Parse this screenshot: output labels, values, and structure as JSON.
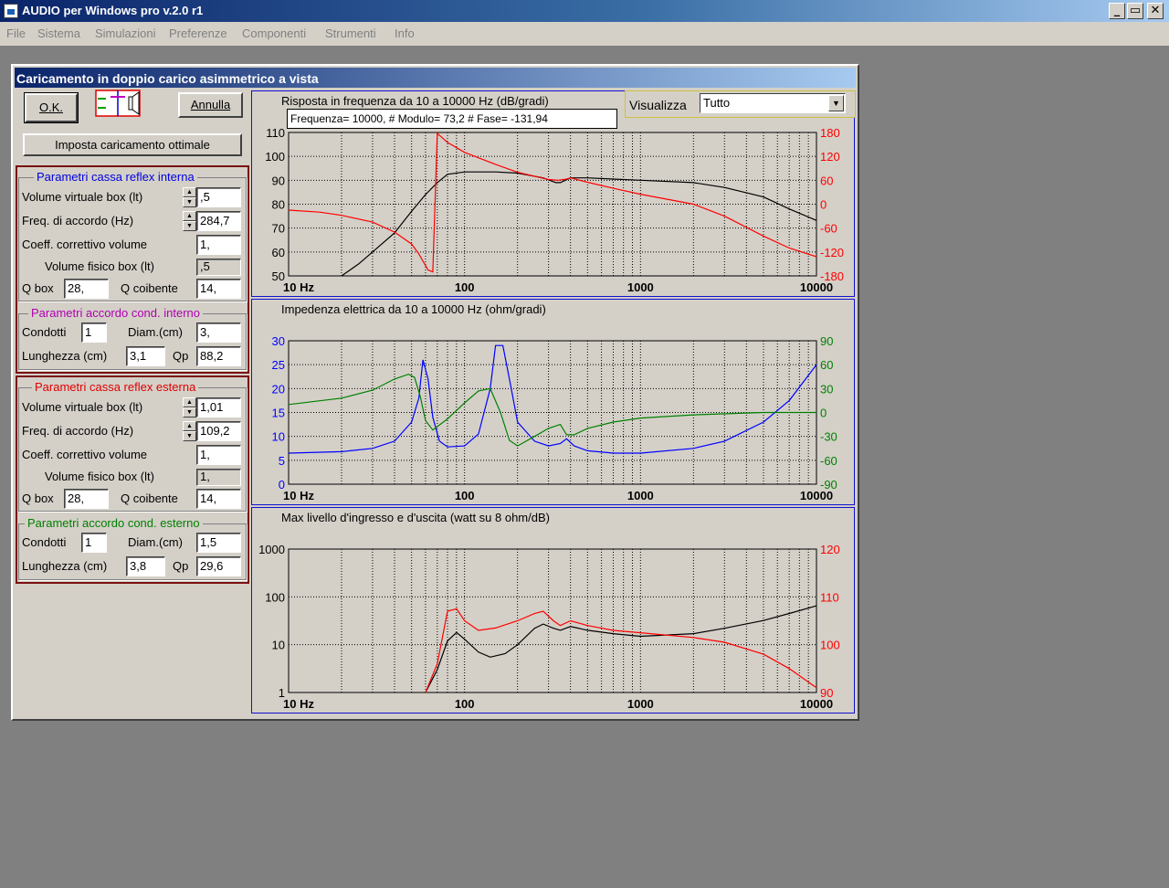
{
  "window": {
    "title": "AUDIO per Windows pro v.2.0 r1",
    "min": "_",
    "max": "▭",
    "close": "✕"
  },
  "menu": [
    "File",
    "Sistema",
    "Simulazioni",
    "Preferenze",
    "Componenti",
    "Strumenti",
    "Info"
  ],
  "dialog": {
    "title": "Caricamento in doppio carico asimmetrico a vista",
    "ok": "O.K.",
    "cancel": "Annulla",
    "optimal": "Imposta caricamento ottimale",
    "internal_box": {
      "legend": "Parametri cassa reflex interna",
      "legend_color": "#0000e0",
      "vol_label": "Volume virtuale box (lt)",
      "vol": ",5",
      "freq_label": "Freq. di accordo (Hz)",
      "freq": "284,7",
      "coef_label": "Coeff. correttivo volume",
      "coef": "1,",
      "phys_label": "Volume fisico box (lt)",
      "phys": ",5",
      "q_label": "Q box",
      "q": "28,",
      "qc_label": "Q coibente",
      "qc": "14,"
    },
    "internal_duct": {
      "legend": "Parametri accordo cond. interno",
      "legend_color": "#b000b0",
      "cond_label": "Condotti",
      "cond": "1",
      "diam_label": "Diam.(cm)",
      "diam": "3,",
      "len_label": "Lunghezza (cm)",
      "len": "3,1",
      "qp_label": "Qp",
      "qp": "88,2"
    },
    "external_box": {
      "legend": "Parametri cassa reflex esterna",
      "legend_color": "#e00000",
      "vol_label": "Volume virtuale box (lt)",
      "vol": "1,01",
      "freq_label": "Freq. di accordo (Hz)",
      "freq": "109,2",
      "coef_label": "Coeff. correttivo volume",
      "coef": "1,",
      "phys_label": "Volume fisico box (lt)",
      "phys": "1,",
      "q_label": "Q box",
      "q": "28,",
      "qc_label": "Q coibente",
      "qc": "14,"
    },
    "external_duct": {
      "legend": "Parametri accordo cond. esterno",
      "legend_color": "#008000",
      "cond_label": "Condotti",
      "cond": "1",
      "diam_label": "Diam.(cm)",
      "diam": "1,5",
      "len_label": "Lunghezza (cm)",
      "len": "3,8",
      "qp_label": "Qp",
      "qp": "29,6"
    },
    "view_label": "Visualizza",
    "view_value": "Tutto",
    "tooltip": "Frequenza= 10000, # Modulo= 73,2 # Fase= -131,94"
  },
  "chart_data": [
    {
      "type": "line",
      "title": "Risposta in frequenza da 10 a 10000 Hz (dB/gradi)",
      "x_scale": "log",
      "xlim": [
        10,
        10000
      ],
      "x_ticks": [
        "10 Hz",
        "100",
        "1000",
        "10000"
      ],
      "y_left": {
        "lim": [
          50,
          110
        ],
        "ticks": [
          "110",
          "100",
          "90",
          "80",
          "70",
          "60",
          "50"
        ],
        "color": "#000000"
      },
      "y_right": {
        "lim": [
          -180,
          180
        ],
        "ticks": [
          "180",
          "120",
          "60",
          "0",
          "-60",
          "-120",
          "-180"
        ],
        "color": "#ff0000"
      },
      "grid": true,
      "series": [
        {
          "axis": "left",
          "color": "#000000",
          "points": [
            [
              20,
              50
            ],
            [
              25,
              55
            ],
            [
              30,
              60
            ],
            [
              40,
              68
            ],
            [
              50,
              77
            ],
            [
              60,
              84
            ],
            [
              70,
              89
            ],
            [
              80,
              92.5
            ],
            [
              100,
              93.5
            ],
            [
              150,
              93.5
            ],
            [
              200,
              93
            ],
            [
              280,
              91
            ],
            [
              330,
              89
            ],
            [
              350,
              89
            ],
            [
              400,
              91
            ],
            [
              500,
              91
            ],
            [
              700,
              90.5
            ],
            [
              1000,
              90
            ],
            [
              2000,
              89
            ],
            [
              3000,
              87
            ],
            [
              5000,
              83
            ],
            [
              7000,
              78
            ],
            [
              10000,
              73.2
            ]
          ]
        },
        {
          "axis": "right",
          "color": "#ff0000",
          "points": [
            [
              10,
              -15
            ],
            [
              15,
              -20
            ],
            [
              20,
              -28
            ],
            [
              30,
              -45
            ],
            [
              40,
              -70
            ],
            [
              50,
              -100
            ],
            [
              55,
              -125
            ],
            [
              62,
              -165
            ],
            [
              66,
              -170
            ],
            [
              70,
              178
            ],
            [
              80,
              155
            ],
            [
              100,
              130
            ],
            [
              150,
              100
            ],
            [
              200,
              80
            ],
            [
              300,
              62
            ],
            [
              340,
              60
            ],
            [
              380,
              63
            ],
            [
              400,
              66
            ],
            [
              500,
              55
            ],
            [
              700,
              40
            ],
            [
              1000,
              25
            ],
            [
              2000,
              0
            ],
            [
              3000,
              -30
            ],
            [
              5000,
              -80
            ],
            [
              7000,
              -110
            ],
            [
              10000,
              -131.94
            ]
          ]
        }
      ]
    },
    {
      "type": "line",
      "title": "Impedenza elettrica da 10 a 10000 Hz (ohm/gradi)",
      "x_scale": "log",
      "xlim": [
        10,
        10000
      ],
      "x_ticks": [
        "10 Hz",
        "100",
        "1000",
        "10000"
      ],
      "y_left": {
        "lim": [
          0,
          30
        ],
        "ticks": [
          "30",
          "25",
          "20",
          "15",
          "10",
          "5",
          "0"
        ],
        "color": "#0000ff"
      },
      "y_right": {
        "lim": [
          -90,
          90
        ],
        "ticks": [
          "90",
          "60",
          "30",
          "0",
          "-30",
          "-60",
          "-90"
        ],
        "color": "#008000"
      },
      "grid": true,
      "series": [
        {
          "axis": "left",
          "color": "#0000ff",
          "points": [
            [
              10,
              6.5
            ],
            [
              20,
              6.8
            ],
            [
              30,
              7.5
            ],
            [
              40,
              9
            ],
            [
              50,
              13
            ],
            [
              55,
              18
            ],
            [
              58,
              26
            ],
            [
              62,
              22
            ],
            [
              66,
              14
            ],
            [
              72,
              9
            ],
            [
              80,
              7.8
            ],
            [
              100,
              8
            ],
            [
              120,
              10.5
            ],
            [
              140,
              20
            ],
            [
              150,
              29
            ],
            [
              165,
              29
            ],
            [
              180,
              22
            ],
            [
              200,
              13
            ],
            [
              250,
              9
            ],
            [
              300,
              8
            ],
            [
              350,
              8.5
            ],
            [
              380,
              9.5
            ],
            [
              420,
              8
            ],
            [
              500,
              7
            ],
            [
              700,
              6.5
            ],
            [
              1000,
              6.5
            ],
            [
              2000,
              7.5
            ],
            [
              3000,
              9
            ],
            [
              5000,
              13
            ],
            [
              7000,
              17.5
            ],
            [
              10000,
              25
            ]
          ]
        },
        {
          "axis": "right",
          "color": "#008000",
          "points": [
            [
              10,
              10
            ],
            [
              20,
              18
            ],
            [
              30,
              28
            ],
            [
              40,
              42
            ],
            [
              48,
              48
            ],
            [
              52,
              44
            ],
            [
              56,
              20
            ],
            [
              60,
              -10
            ],
            [
              66,
              -22
            ],
            [
              80,
              -8
            ],
            [
              100,
              12
            ],
            [
              120,
              27
            ],
            [
              140,
              30
            ],
            [
              160,
              0
            ],
            [
              180,
              -35
            ],
            [
              200,
              -42
            ],
            [
              250,
              -30
            ],
            [
              300,
              -20
            ],
            [
              350,
              -15
            ],
            [
              380,
              -28
            ],
            [
              420,
              -28
            ],
            [
              500,
              -20
            ],
            [
              700,
              -12
            ],
            [
              1000,
              -7
            ],
            [
              2000,
              -3
            ],
            [
              5000,
              0
            ],
            [
              10000,
              0
            ]
          ]
        }
      ]
    },
    {
      "type": "line",
      "title": "Max livello d'ingresso e d'uscita (watt su 8 ohm/dB)",
      "x_scale": "log",
      "xlim": [
        10,
        10000
      ],
      "x_ticks": [
        "10 Hz",
        "100",
        "1000",
        "10000"
      ],
      "y_left": {
        "lim": [
          1,
          1000
        ],
        "scale": "log",
        "ticks": [
          "1000",
          "100",
          "10",
          "1"
        ],
        "color": "#000000"
      },
      "y_right": {
        "lim": [
          90,
          120
        ],
        "ticks": [
          "120",
          "110",
          "100",
          "90"
        ],
        "color": "#ff0000"
      },
      "grid": true,
      "series": [
        {
          "axis": "left",
          "color": "#000000",
          "points": [
            [
              60,
              1
            ],
            [
              70,
              3
            ],
            [
              80,
              12
            ],
            [
              90,
              18
            ],
            [
              100,
              13
            ],
            [
              120,
              7
            ],
            [
              140,
              5.5
            ],
            [
              170,
              6.5
            ],
            [
              200,
              10
            ],
            [
              250,
              22
            ],
            [
              280,
              27
            ],
            [
              320,
              22
            ],
            [
              350,
              20
            ],
            [
              400,
              24
            ],
            [
              500,
              20
            ],
            [
              700,
              17
            ],
            [
              1000,
              15
            ],
            [
              2000,
              17
            ],
            [
              3000,
              22
            ],
            [
              5000,
              32
            ],
            [
              7000,
              45
            ],
            [
              10000,
              65
            ]
          ]
        },
        {
          "axis": "right",
          "color": "#ff0000",
          "points": [
            [
              60,
              90
            ],
            [
              70,
              96
            ],
            [
              80,
              107
            ],
            [
              90,
              107.5
            ],
            [
              100,
              105
            ],
            [
              120,
              103
            ],
            [
              150,
              103.5
            ],
            [
              200,
              105
            ],
            [
              250,
              106.5
            ],
            [
              280,
              107
            ],
            [
              320,
              105
            ],
            [
              350,
              104
            ],
            [
              400,
              105
            ],
            [
              500,
              104
            ],
            [
              700,
              103
            ],
            [
              1000,
              102.5
            ],
            [
              2000,
              101.5
            ],
            [
              3000,
              100.5
            ],
            [
              5000,
              98
            ],
            [
              7000,
              95
            ],
            [
              10000,
              91
            ]
          ]
        }
      ]
    }
  ]
}
